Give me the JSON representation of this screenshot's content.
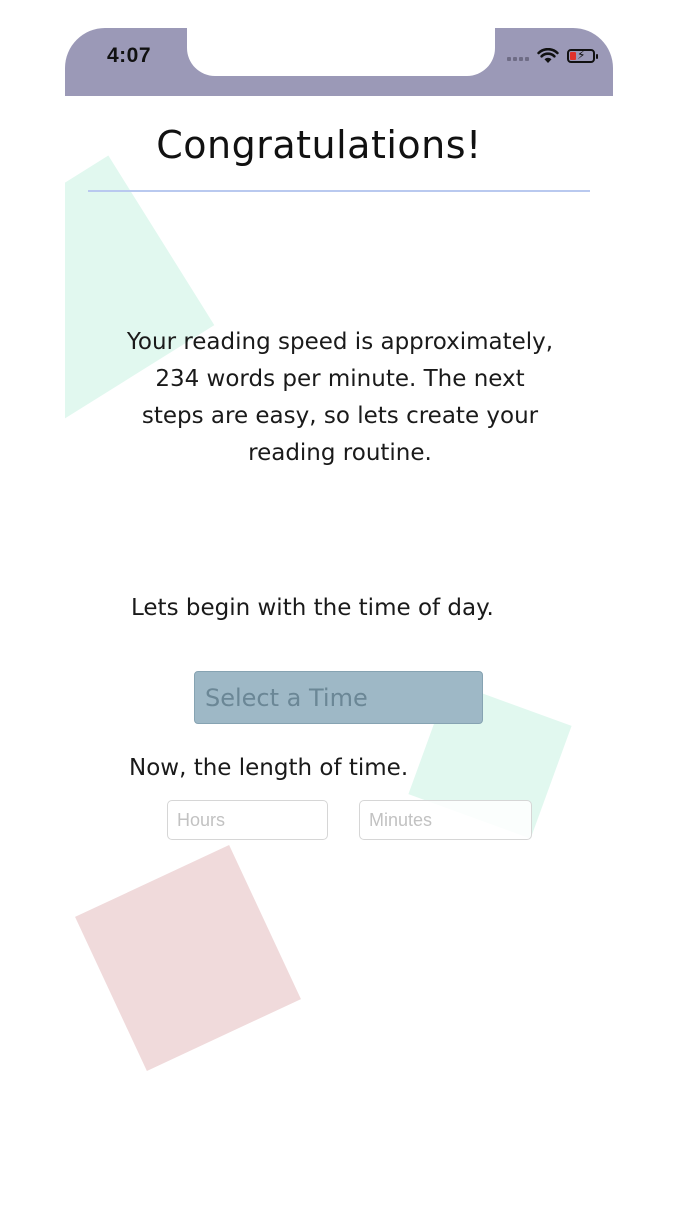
{
  "status_bar": {
    "time": "4:07",
    "icons": [
      "signal-icon",
      "wifi-icon",
      "battery-icon"
    ],
    "background": "#9b99b7"
  },
  "page": {
    "title": "Congratulations!",
    "message": "Your reading speed is approximately, 234 words per minute. The next steps are easy, so lets create your reading routine.",
    "time_prompt": "Lets begin with the time of day.",
    "select_time_label": "Select a Time",
    "length_prompt": "Now, the length of time.",
    "hours_placeholder": "Hours",
    "minutes_placeholder": "Minutes"
  },
  "colors": {
    "accent_rule": "#b9c9ef",
    "select_button": "#9eb8c6",
    "shape_green": "#e1f8ef",
    "shape_pink": "#f0dadb"
  }
}
